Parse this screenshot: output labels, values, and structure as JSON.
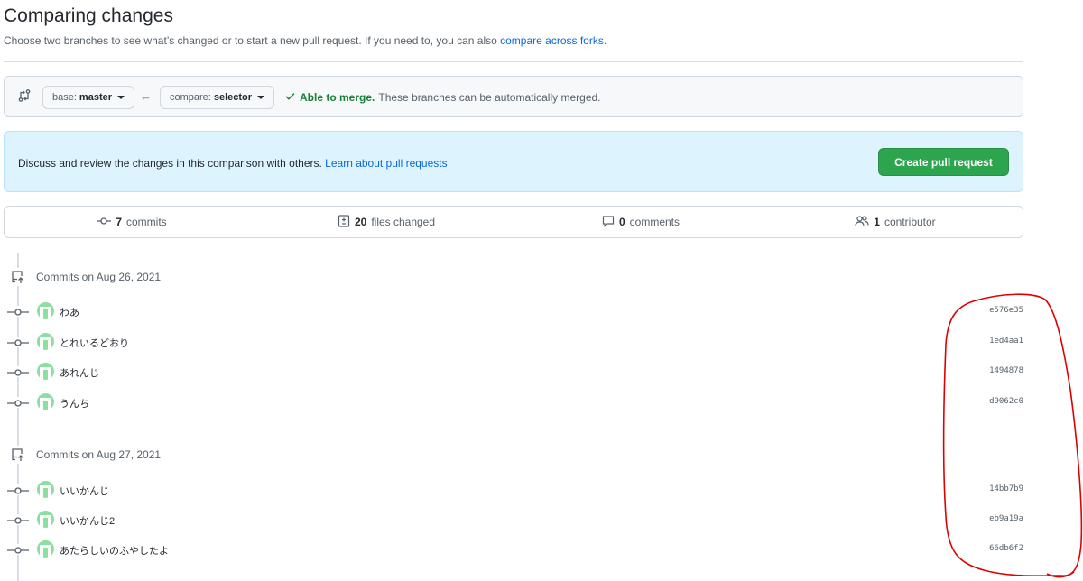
{
  "header": {
    "title": "Comparing changes",
    "subtitle": "Choose two branches to see what’s changed or to start a new pull request. If you need to, you can also",
    "subtitle_link": "compare across forks",
    "subtitle_end": "."
  },
  "range": {
    "base_prefix": "base:",
    "base_branch": "master",
    "compare_prefix": "compare:",
    "compare_branch": "selector",
    "merge_ok": "Able to merge.",
    "merge_text": "These branches can be automatically merged."
  },
  "blank_slate": {
    "text": "Discuss and review the changes in this comparison with others.",
    "link": "Learn about pull requests",
    "button": "Create pull request"
  },
  "summary": {
    "commits_count": "7",
    "commits_label": "commits",
    "files_count": "20",
    "files_label": "files changed",
    "comments_count": "0",
    "comments_label": "comments",
    "contributors_count": "1",
    "contributors_label": "contributor"
  },
  "days": [
    {
      "header": "Commits on Aug 26, 2021",
      "commits": [
        {
          "message": "わあ",
          "sha": "e576e35"
        },
        {
          "message": "とれいるどおり",
          "sha": "1ed4aa1"
        },
        {
          "message": "あれんじ",
          "sha": "1494878"
        },
        {
          "message": "うんち",
          "sha": "d9062c0"
        }
      ]
    },
    {
      "header": "Commits on Aug 27, 2021",
      "commits": [
        {
          "message": "いいかんじ",
          "sha": "14bb7b9"
        },
        {
          "message": "いいかんじ2",
          "sha": "eb9a19a"
        },
        {
          "message": "あたらしいのふやしたよ",
          "sha": "66db6f2"
        }
      ]
    }
  ],
  "colors": {
    "primary_button": "#2da44e",
    "link": "#0969da",
    "merge_ok": "#1a7f37",
    "blank_slate_bg": "#ddf4ff",
    "annotation": "#e00000"
  },
  "icons": {
    "range": "git-compare-icon",
    "arrow": "arrow-left-icon",
    "check": "check-icon",
    "commit": "git-commit-icon",
    "file_diff": "file-diff-icon",
    "comment": "comment-icon",
    "people": "people-icon",
    "repo_push": "repo-push-icon"
  }
}
